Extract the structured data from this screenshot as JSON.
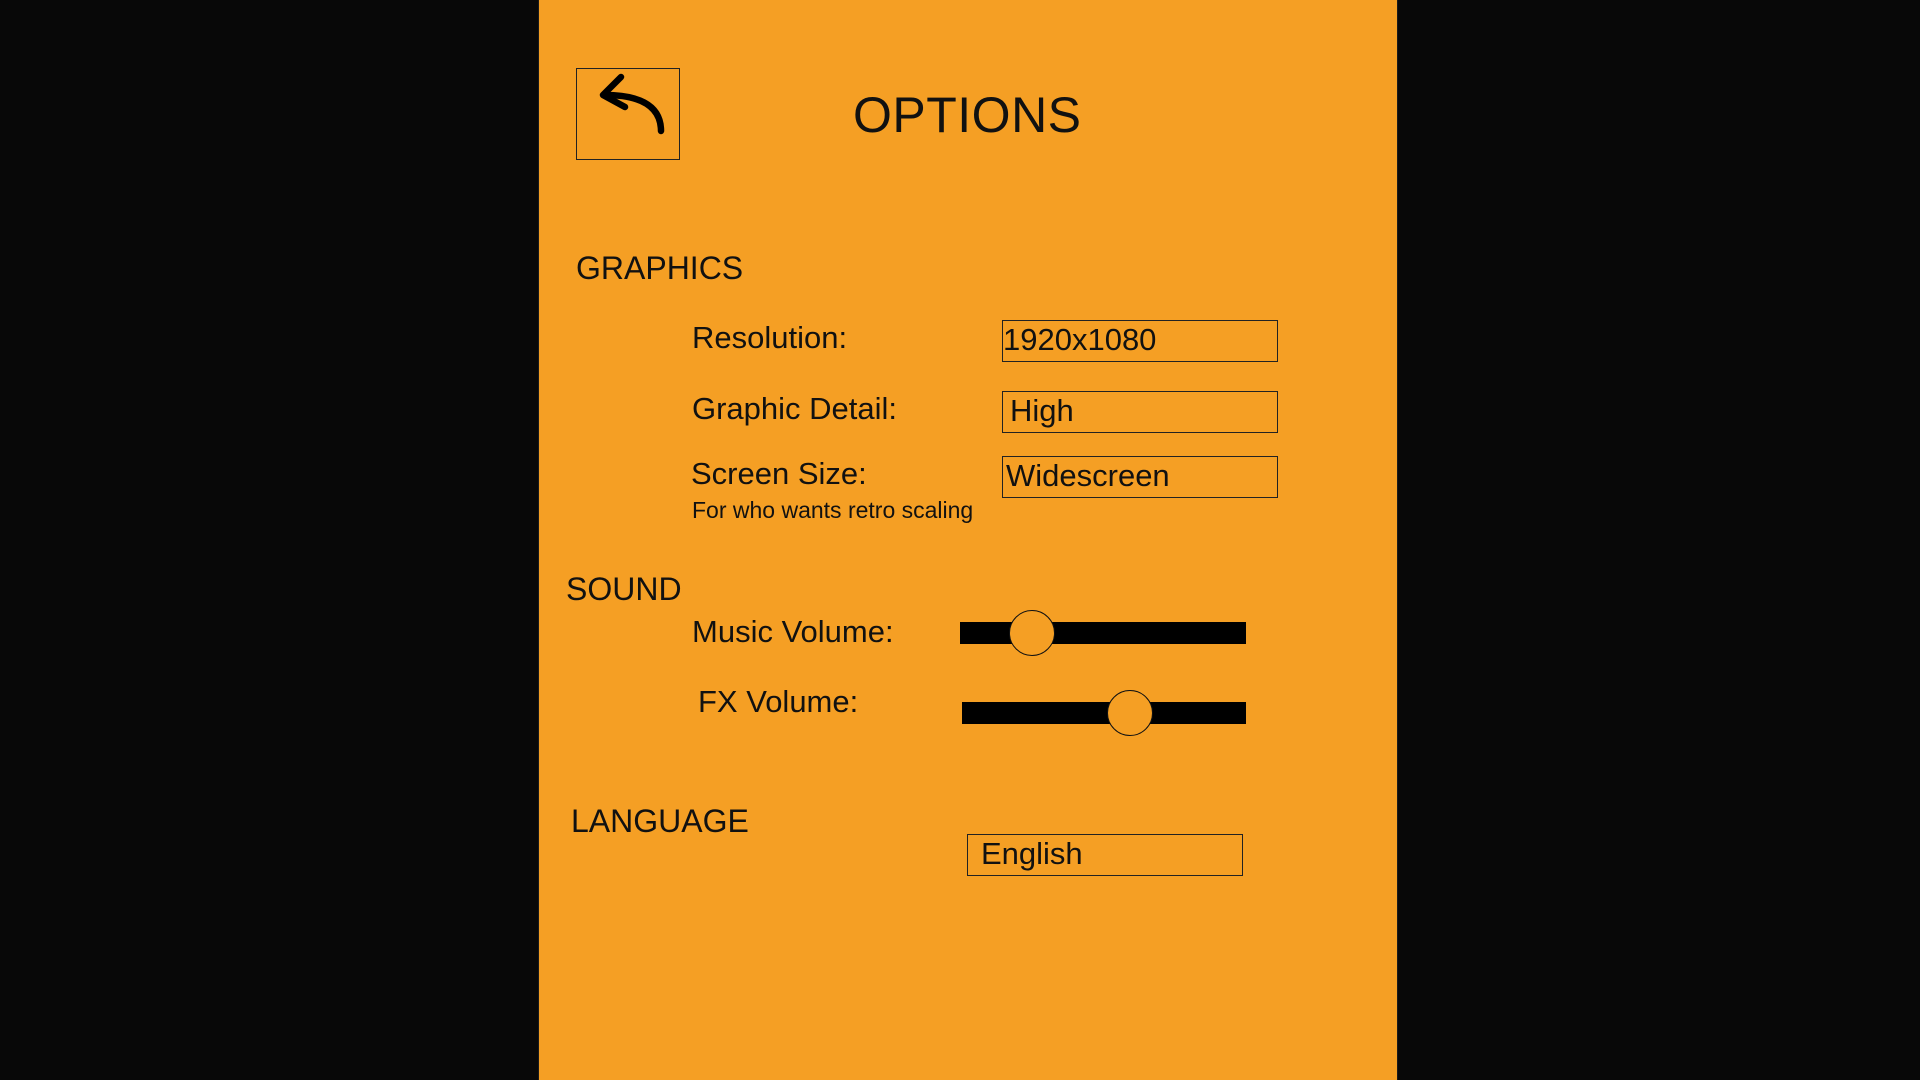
{
  "title": "OPTIONS",
  "back_button": {
    "icon": "back-arrow-icon"
  },
  "graphics": {
    "heading": "GRAPHICS",
    "resolution": {
      "label": "Resolution:",
      "value": "1920x1080"
    },
    "graphic_detail": {
      "label": "Graphic Detail:",
      "value": "High"
    },
    "screen_size": {
      "label": "Screen Size:",
      "hint": "For who wants retro scaling",
      "value": "Widescreen"
    }
  },
  "sound": {
    "heading": "SOUND",
    "music_volume": {
      "label": "Music Volume:",
      "level": 0.25
    },
    "fx_volume": {
      "label": "FX Volume:",
      "level": 0.59
    }
  },
  "language": {
    "heading": "LANGUAGE",
    "value": "English"
  },
  "colors": {
    "panel": "#f59f24",
    "background": "#080808",
    "slider_track": "#000000"
  }
}
